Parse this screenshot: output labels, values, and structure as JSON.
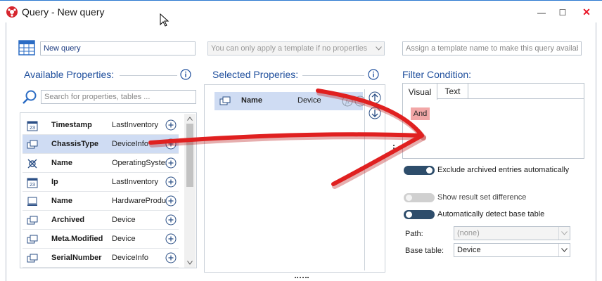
{
  "window": {
    "title": "Query - New query",
    "controls": {
      "minimize": "—",
      "maximize": "☐",
      "close": "✕"
    }
  },
  "header": {
    "query_name": "New query",
    "template_select_text": "You can only apply a template if no properties",
    "template_name_placeholder": "Assign a template name to make this query available"
  },
  "available": {
    "title": "Available Properties:",
    "search_placeholder": "Search for properties, tables ...",
    "items": [
      {
        "icon": "calendar-icon",
        "name": "Timestamp",
        "table": "LastInventory",
        "selected": false
      },
      {
        "icon": "chassis-icon",
        "name": "ChassisType",
        "table": "DeviceInfo",
        "selected": true
      },
      {
        "icon": "os-icon",
        "name": "Name",
        "table": "OperatingSystem",
        "selected": false
      },
      {
        "icon": "calendar-icon",
        "name": "Ip",
        "table": "LastInventory",
        "selected": false
      },
      {
        "icon": "hardware-icon",
        "name": "Name",
        "table": "HardwareProduct",
        "selected": false
      },
      {
        "icon": "device-icon",
        "name": "Archived",
        "table": "Device",
        "selected": false
      },
      {
        "icon": "device-icon",
        "name": "Meta.Modified",
        "table": "Device",
        "selected": false
      },
      {
        "icon": "device-icon",
        "name": "SerialNumber",
        "table": "DeviceInfo",
        "selected": false
      }
    ]
  },
  "selected": {
    "title": "Selected Properies:",
    "items": [
      {
        "icon": "device-icon",
        "name": "Name",
        "table": "Device"
      }
    ]
  },
  "filter": {
    "title": "Filter Condition:",
    "tabs": [
      "Visual",
      "Text"
    ],
    "active_tab": "Visual",
    "and_label": "And",
    "options": [
      {
        "label": "Exclude archived entries automatically",
        "on": true
      },
      {
        "label": "Show result set difference",
        "on": false,
        "disabled": true
      },
      {
        "label": "Automatically detect base table",
        "on": false
      }
    ],
    "path_label": "Path:",
    "path_value": "(none)",
    "base_table_label": "Base table:",
    "base_table_value": "Device"
  },
  "colors": {
    "accent": "#1e4e9c",
    "selection": "#cfdcf3",
    "toggle_on": "#2e4d6b",
    "annotation": "#e02020",
    "and_badge": "#f2a7a7"
  }
}
